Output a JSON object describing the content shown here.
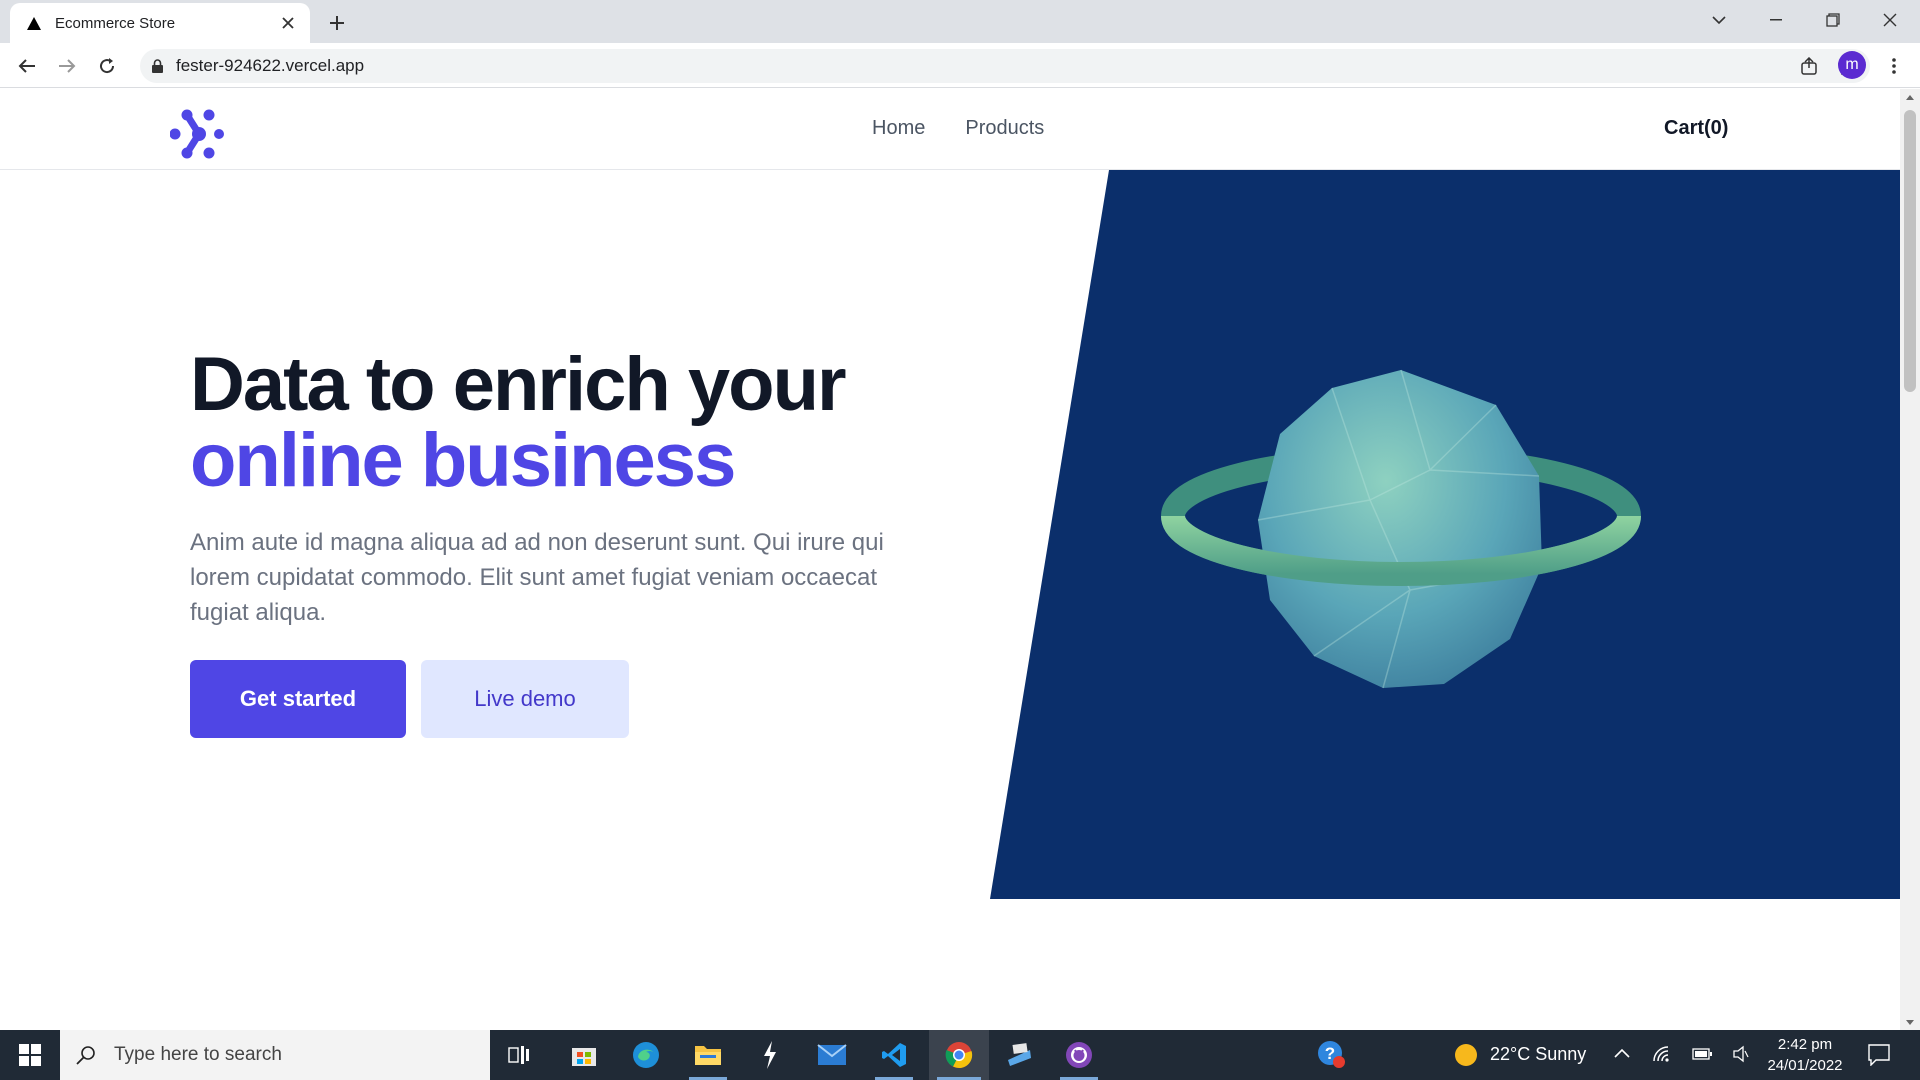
{
  "browser": {
    "tab_title": "Ecommerce Store",
    "url": "fester-924622.vercel.app",
    "profile_initial": "m"
  },
  "site": {
    "nav": [
      "Home",
      "Products"
    ],
    "cart_label": "Cart(0)"
  },
  "hero": {
    "title_line1": "Data to enrich your",
    "title_line2": "online business",
    "description": "Anim aute id magna aliqua ad ad non deserunt sunt. Qui irure qui lorem cupidatat commodo. Elit sunt amet fugiat veniam occaecat fugiat aliqua.",
    "primary_cta": "Get started",
    "secondary_cta": "Live demo"
  },
  "taskbar": {
    "search_placeholder": "Type here to search",
    "weather": "22°C  Sunny",
    "time": "2:42 pm",
    "date": "24/01/2022"
  },
  "colors": {
    "accent": "#4f46e5",
    "panel": "#0b2f6b",
    "accent_light": "#e0e7ff"
  }
}
